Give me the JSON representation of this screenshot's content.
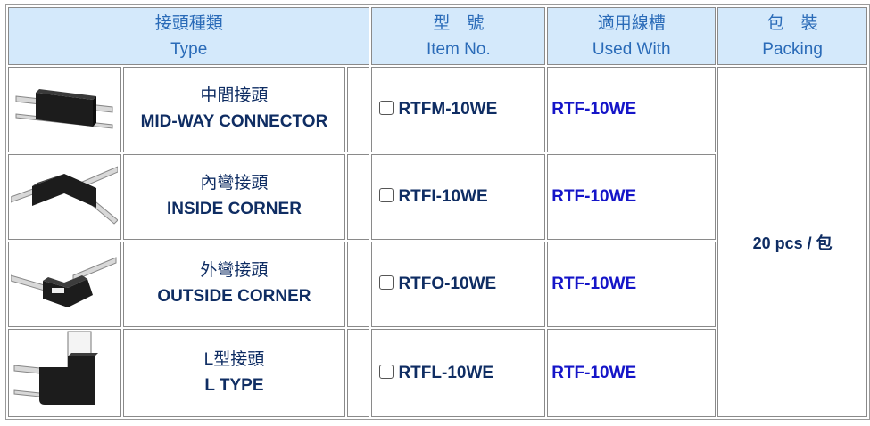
{
  "header": {
    "type_cn": "接頭種類",
    "type_en": "Type",
    "item_cn": "型　號",
    "item_en": "Item No.",
    "used_cn": "適用線槽",
    "used_en": "Used With",
    "pack_cn": "包　裝",
    "pack_en": "Packing"
  },
  "rows": [
    {
      "name_cn": "中間接頭",
      "name_en": "MID-WAY CONNECTOR",
      "item_no": "RTFM-10WE",
      "used_with": "RTF-10WE",
      "image_icon": "mid-way-connector-icon"
    },
    {
      "name_cn": "內彎接頭",
      "name_en": "INSIDE CORNER",
      "item_no": "RTFI-10WE",
      "used_with": "RTF-10WE",
      "image_icon": "inside-corner-icon"
    },
    {
      "name_cn": "外彎接頭",
      "name_en": "OUTSIDE CORNER",
      "item_no": "RTFO-10WE",
      "used_with": "RTF-10WE",
      "image_icon": "outside-corner-icon"
    },
    {
      "name_cn": "L型接頭",
      "name_en": "L TYPE",
      "item_no": "RTFL-10WE",
      "used_with": "RTF-10WE",
      "image_icon": "l-type-icon"
    }
  ],
  "packing": "20 pcs / 包",
  "colors": {
    "header_bg": "#d4e9fb",
    "header_text": "#2a6bb8",
    "name_text": "#0f2d63",
    "used_with_text": "#1515c8"
  }
}
